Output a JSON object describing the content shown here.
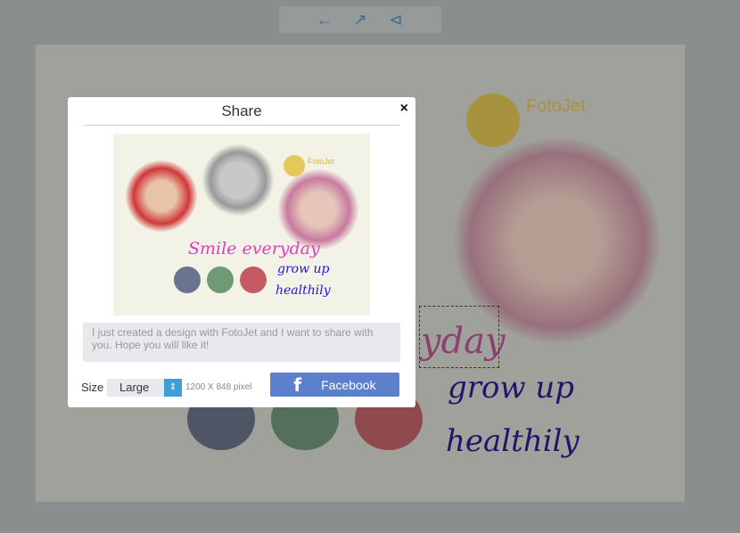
{
  "toolbar": {
    "icons": [
      "arrow-left-icon",
      "external-link-icon",
      "share-icon"
    ]
  },
  "canvas": {
    "logo_text": "FotoJet",
    "text_1": "yday",
    "text_2": "grow up",
    "text_3": "healthily"
  },
  "modal": {
    "title": "Share",
    "close": "×",
    "preview": {
      "logo_text": "FotoJet",
      "text_1": "Smile everyday",
      "text_2": "grow up",
      "text_3": "healthily"
    },
    "message": "I just created a design with FotoJet and I want to share with you. Hope you will like it!",
    "size_label": "Size",
    "size_value": "Large",
    "size_pixels": "1200 X 848 pixel",
    "facebook_label": "Facebook"
  },
  "colors": {
    "facebook": "#5b80cc",
    "select_arrow": "#3d9fd3"
  }
}
